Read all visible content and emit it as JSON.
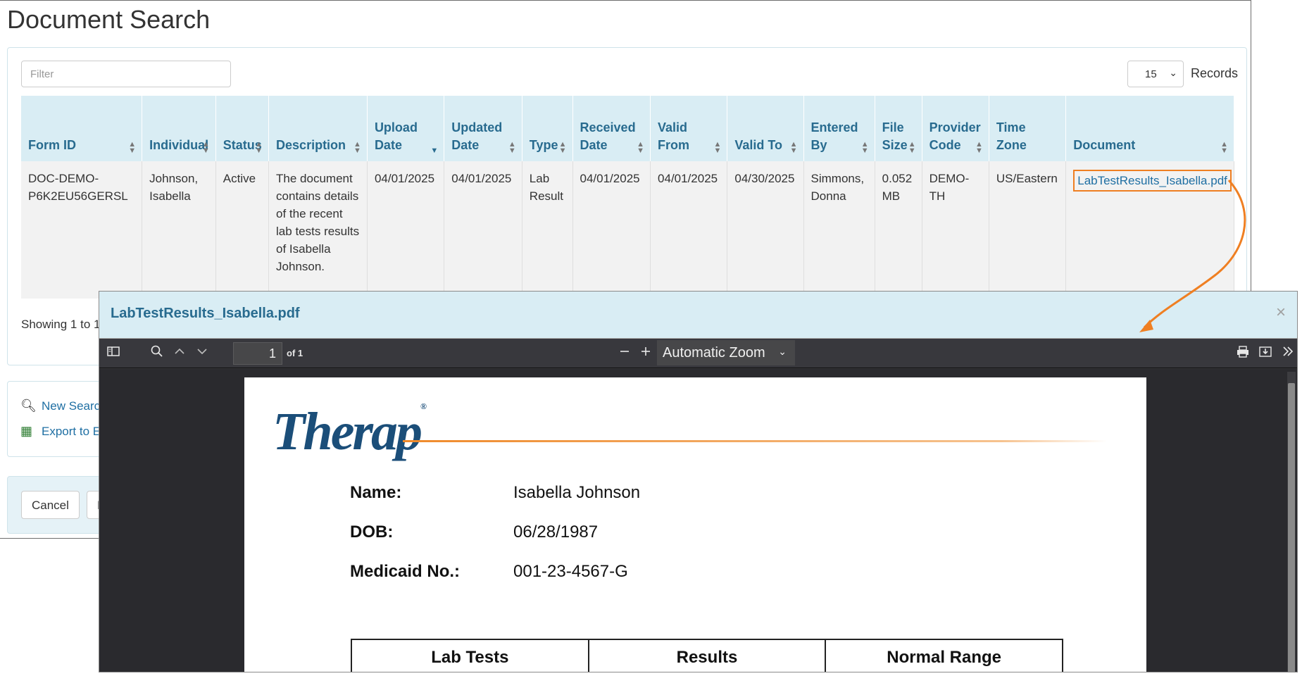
{
  "page": {
    "title": "Document Search"
  },
  "search": {
    "filter_placeholder": "Filter",
    "records_value": "15",
    "records_label": "Records"
  },
  "table": {
    "headers": [
      "Form ID",
      "Individual",
      "Status",
      "Description",
      "Upload Date",
      "Updated Date",
      "Type",
      "Received Date",
      "Valid From",
      "Valid To",
      "Entered By",
      "File Size",
      "Provider Code",
      "Time Zone",
      "Document"
    ],
    "rows": [
      {
        "form_id": "DOC-DEMO-P6K2EU56GERSL",
        "individual": "Johnson, Isabella",
        "status": "Active",
        "description": "The document contains details of the recent lab tests results of Isabella Johnson.",
        "upload_date": "04/01/2025",
        "updated_date": "04/01/2025",
        "type": "Lab Result",
        "received_date": "04/01/2025",
        "valid_from": "04/01/2025",
        "valid_to": "04/30/2025",
        "entered_by": "Simmons, Donna",
        "file_size": "0.052 MB",
        "provider_code": "DEMO-TH",
        "time_zone": "US/Eastern",
        "document": "LabTestResults_Isabella.pdf"
      }
    ],
    "showing": "Showing 1 to 1"
  },
  "actions": {
    "new_search": "New Search",
    "export": "Export to E"
  },
  "footer": {
    "cancel": "Cancel",
    "second": "B"
  },
  "modal": {
    "title": "LabTestResults_Isabella.pdf",
    "close": "×",
    "toolbar": {
      "page_number": "1",
      "page_of": "of 1",
      "zoom": "Automatic Zoom"
    },
    "pdf": {
      "logo": "Therap",
      "logo_mark": "®",
      "fields": [
        {
          "label": "Name:",
          "value": "Isabella Johnson"
        },
        {
          "label": "DOB:",
          "value": "06/28/1987"
        },
        {
          "label": "Medicaid No.:",
          "value": "001-23-4567-G"
        }
      ],
      "lab_table_headers": [
        "Lab Tests",
        "Results",
        "Normal Range"
      ]
    }
  },
  "colors": {
    "header_bg": "#d9edf4",
    "header_text": "#286b8f",
    "link": "#1f6fa3",
    "highlight_orange": "#ef7f22",
    "pdf_toolbar": "#38383d",
    "therap_blue": "#1b4e79"
  },
  "icons": [
    "sidebar-toggle-icon",
    "search-icon",
    "chevron-up-icon",
    "chevron-down-icon",
    "zoom-out-icon",
    "zoom-in-icon",
    "print-icon",
    "download-icon",
    "double-chevron-right-icon",
    "magnifier-icon",
    "excel-icon",
    "close-icon"
  ]
}
